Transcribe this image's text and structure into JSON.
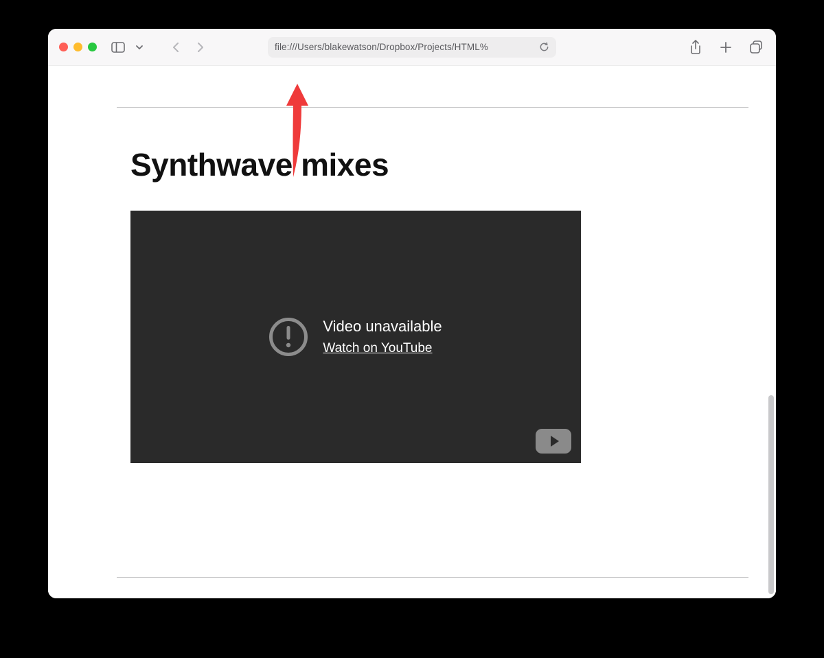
{
  "toolbar": {
    "url": "file:///Users/blakewatson/Dropbox/Projects/HTML%"
  },
  "page": {
    "heading": "Synthwave mixes"
  },
  "video": {
    "unavailable_title": "Video unavailable",
    "watch_link": "Watch on YouTube"
  },
  "icons": {
    "sidebar": "sidebar-icon",
    "chevron_down": "chevron-down-icon",
    "back": "chevron-left-icon",
    "forward": "chevron-right-icon",
    "reload": "reload-icon",
    "share": "share-icon",
    "plus": "plus-icon",
    "tabs": "tab-overview-icon",
    "exclaim": "exclamation-icon",
    "youtube": "youtube-icon",
    "annotation_arrow": "annotation-arrow-icon"
  }
}
